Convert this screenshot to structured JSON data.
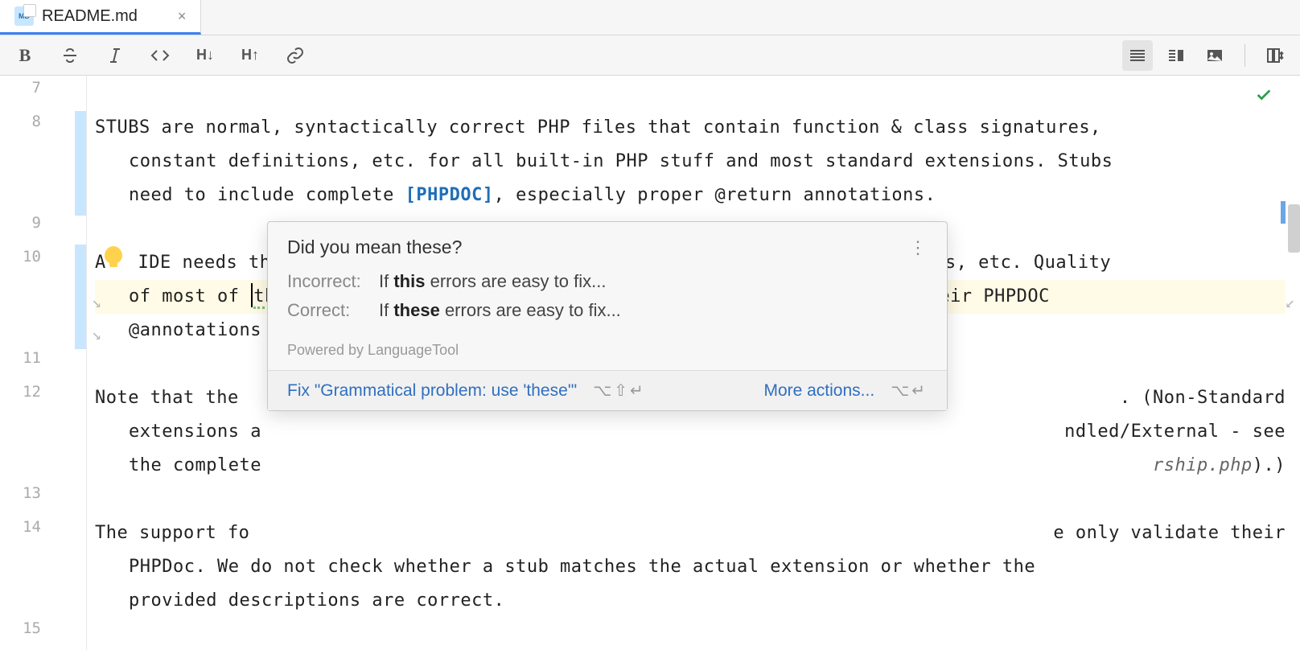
{
  "tab": {
    "icon_label": "MD",
    "title": "README.md",
    "close_glyph": "×"
  },
  "toolbar": {
    "bold": "B",
    "hdec": "H↓",
    "hinc": "H↑"
  },
  "gutter": {
    "lines": [
      "7",
      "8",
      "9",
      "10",
      "11",
      "12",
      "13",
      "14",
      "15"
    ]
  },
  "editor": {
    "l8a": "STUBS are normal, syntactically correct PHP files that contain function & class signatures,",
    "l8b_pre": "constant definitions, etc. for all built-in PHP stuff and most standard extensions. Stubs",
    "l8c_pre": "need to include complete ",
    "l8c_link": "[PHPDOC]",
    "l8c_post": ", especially proper @return annotations.",
    "l10a_pre": "A",
    "l10a_post": " IDE needs them for completion, code inspection, type inference, doc popups, etc. Quality",
    "l10b_pre": "of most of ",
    "l10b_this": "this",
    "l10b_post": " services depend on the quality of the stubs (basically their PHPDOC",
    "l10c": "@annotations",
    "l12a": "Note that the",
    "l12a_tail": ". (Non-Standard",
    "l12b_head": "extensions a",
    "l12b_tail": "ndled/External - see",
    "l12c_head": "the complete",
    "l12c_ital": "rship.php",
    "l12c_tail": ").)",
    "l14a": "The support fo",
    "l14a_tail": "e only validate their",
    "l14b": "PHPDoc. We do not check whether a stub matches the actual extension or whether the",
    "l14c": "provided descriptions are correct."
  },
  "popup": {
    "title": "Did you mean these?",
    "more_glyph": "⋮",
    "incorrect_label": "Incorrect:",
    "incorrect_pre": "If ",
    "incorrect_bold": "this",
    "incorrect_post": " errors are easy to fix...",
    "correct_label": "Correct:",
    "correct_pre": "If ",
    "correct_bold": "these",
    "correct_post": " errors are easy to fix...",
    "powered": "Powered by LanguageTool",
    "fix_label": "Fix \"Grammatical problem: use 'these'\"",
    "fix_shortcut": "⌥⇧↵",
    "more_actions": "More actions...",
    "more_shortcut": "⌥↵"
  }
}
